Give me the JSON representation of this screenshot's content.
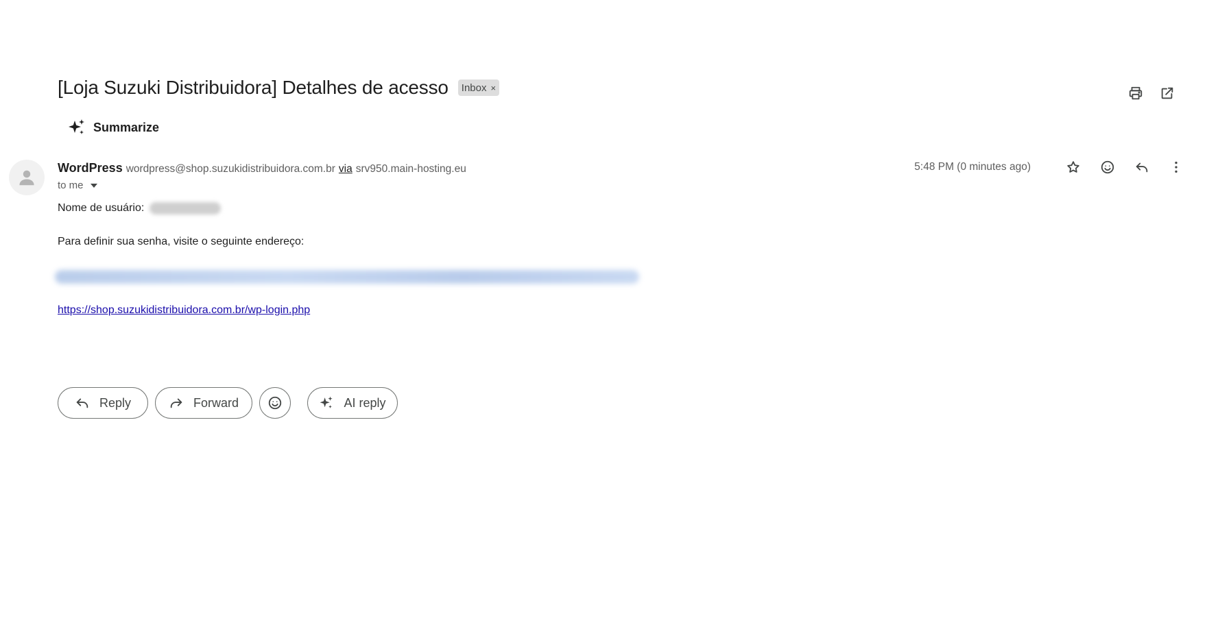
{
  "subject": {
    "title": "[Loja Suzuki Distribuidora] Detalhes de acesso",
    "label": "Inbox",
    "label_remove": "×"
  },
  "summarize": {
    "label": "Summarize"
  },
  "message": {
    "sender_name": "WordPress",
    "sender_email": "wordpress@shop.suzukidistribuidora.com.br",
    "via_label": "via",
    "via_host": "srv950.main-hosting.eu",
    "recipient": "to me",
    "timestamp": "5:48 PM (0 minutes ago)",
    "body": {
      "username_label": "Nome de usuário:",
      "password_instruction": "Para definir sua senha, visite o seguinte endereço:",
      "login_link": "https://shop.suzukidistribuidora.com.br/wp-login.php"
    }
  },
  "actions": {
    "reply": "Reply",
    "forward": "Forward",
    "ai_reply": "AI reply"
  },
  "icons": {
    "print": "print-icon",
    "open_new_window": "open-in-new-icon",
    "sparkle": "sparkle-icon",
    "star": "star-icon",
    "emoji": "emoji-icon",
    "reply": "reply-icon",
    "more": "more-vert-icon",
    "forward": "forward-icon",
    "avatar": "person-icon"
  },
  "colors": {
    "link": "#1a0dab",
    "chip_bg": "#dddddd",
    "border": "#747775",
    "muted_text": "#5e5e5e"
  }
}
